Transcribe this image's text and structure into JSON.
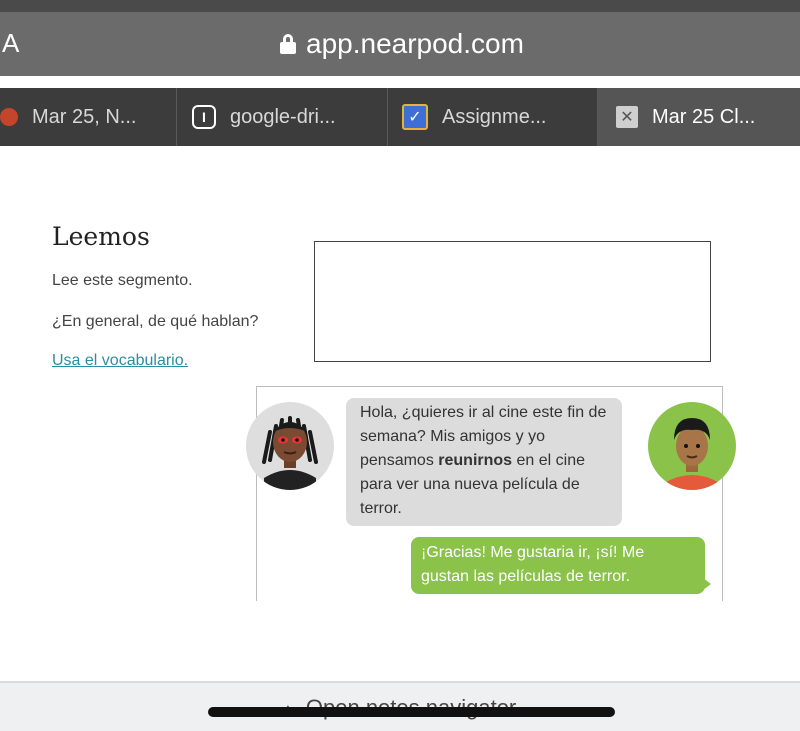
{
  "browser": {
    "left_label": "A",
    "url": "app.nearpod.com"
  },
  "tabs": [
    {
      "label": "Mar 25, N...",
      "icon": "nearpod-icon"
    },
    {
      "label": "google-dri...",
      "icon": "drive-icon",
      "icon_text": "I"
    },
    {
      "label": "Assignme...",
      "icon": "assignment-icon",
      "icon_text": "✓"
    },
    {
      "label": "Mar 25 Cl...",
      "icon": "close-icon",
      "icon_text": "✕"
    }
  ],
  "lesson": {
    "title": "Leemos",
    "instruction_1": "Lee este segmento.",
    "instruction_2": "¿En general, de qué hablan?",
    "vocab_link": "Usa el vocabulario."
  },
  "conversation": {
    "msg1_part1": "Hola, ¿quieres ir al cine este fin de semana? Mis amigos y yo pensamos ",
    "msg1_bold": "reunirnos",
    "msg1_part2": " en el cine para ver una nueva película de terror.",
    "msg2": "¡Gracias! Me gustaria ir, ¡sí! Me gustan las películas de terror."
  },
  "bottom": {
    "notes_navigator": "Open notes navigator",
    "caret_icon": "▲"
  },
  "colors": {
    "bubble_in": "#dcdcdc",
    "bubble_out": "#8bc34a",
    "link": "#2a8fa0"
  }
}
